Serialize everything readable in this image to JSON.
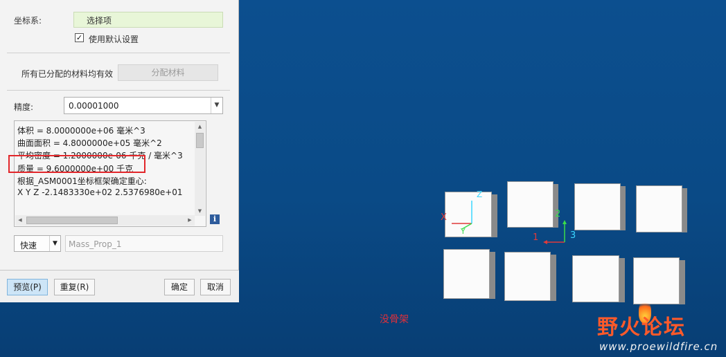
{
  "dialog": {
    "coord_label": "坐标系:",
    "coord_value": "选择项",
    "use_default_label": "使用默认设置",
    "use_default_checked": true,
    "material_text": "所有已分配的材料均有效",
    "assign_material_label": "分配材料",
    "precision_label": "精度:",
    "precision_value": "0.00001000",
    "results": [
      "体积 =   8.0000000e+06  毫米^3",
      "曲面面积 =   4.8000000e+05  毫米^2",
      "平均密度 =   1.2000000e-06 千克 / 毫米^3",
      "质量 =   9.6000000e+00 千克",
      "根据_ASM0001坐标框架确定重心:",
      "X   Y   Z     -2.1483330e+02  2.5376980e+01"
    ],
    "speed_value": "快速",
    "name_placeholder": "Mass_Prop_1",
    "buttons": {
      "preview": "预览(P)",
      "repeat": "重复(R)",
      "ok": "确定",
      "cancel": "取消"
    }
  },
  "viewport": {
    "caption": "没骨架",
    "watermark_cn": "野火论坛",
    "watermark_en": "www.proewildfire.cn",
    "csys1": {
      "x": "X",
      "y": "Y",
      "z": "Z"
    },
    "csys2": {
      "label1": "1",
      "label2": "2",
      "label3": "3"
    }
  },
  "colors": {
    "background": "#0a4a86",
    "highlight": "#e2262a",
    "input_green": "#e8f6d8",
    "axis_red": "#e03a3a",
    "axis_green": "#3adc4a",
    "axis_cyan": "#3ad6ff"
  }
}
